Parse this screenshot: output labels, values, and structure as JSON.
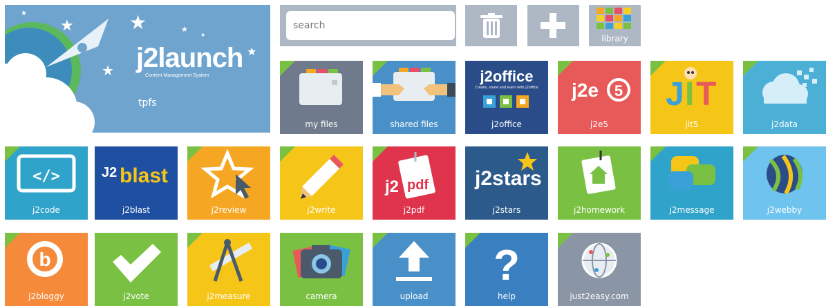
{
  "banner": {
    "logo": "j2launch",
    "tagline": "Content Management System",
    "user": "tpfs"
  },
  "search": {
    "placeholder": "search"
  },
  "toolbar": {
    "library_label": "library"
  },
  "tiles": {
    "my_files": "my files",
    "shared_files": "shared files",
    "j2office": "j2office",
    "j2office_logo": "j2office",
    "j2office_tagline": "Create, share and learn with j2office",
    "j2e5": "j2e5",
    "jit5": "jit5",
    "j2data": "j2data",
    "j2code": "j2code",
    "j2blast": "j2blast",
    "j2review": "j2review",
    "j2write": "j2write",
    "j2pdf": "j2pdf",
    "j2stars": "j2stars",
    "j2homework": "j2homework",
    "j2message": "j2message",
    "j2webby": "j2webby",
    "j2bloggy": "j2bloggy",
    "j2vote": "j2vote",
    "j2measure": "j2measure",
    "camera": "camera",
    "upload": "upload",
    "help": "help",
    "just2easy": "just2easy.com"
  },
  "colors": {
    "toolbar_bg": "#aeb8c4",
    "banner_bg": "#6fa4cf",
    "corner_green": "#7ac143"
  }
}
